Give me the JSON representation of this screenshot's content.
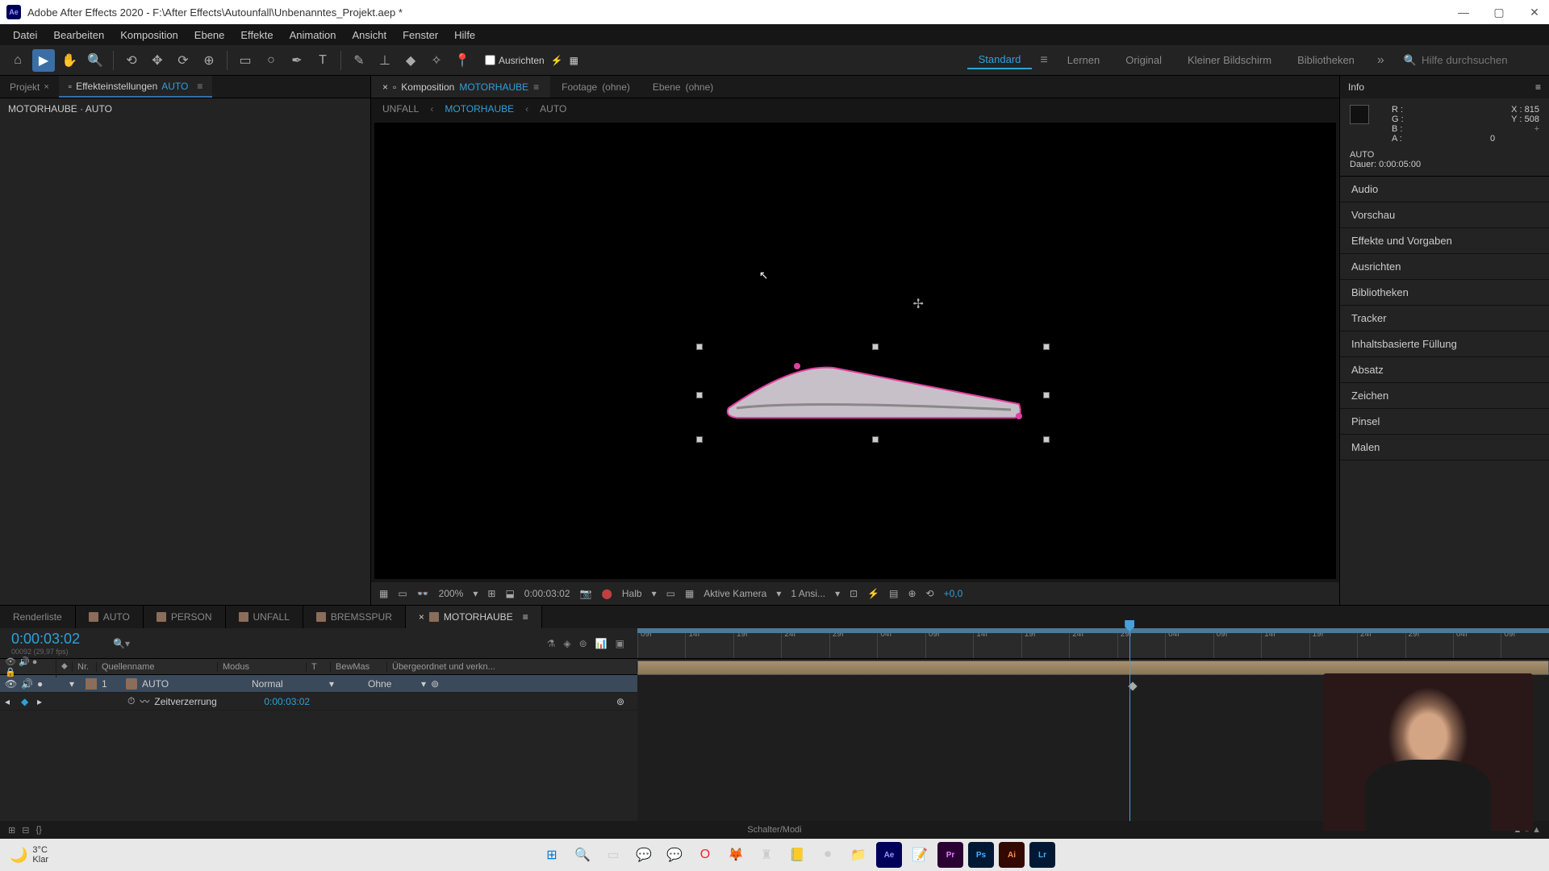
{
  "titlebar": {
    "icon_label": "Ae",
    "title": "Adobe After Effects 2020 - F:\\After Effects\\Autounfall\\Unbenanntes_Projekt.aep *",
    "minimize": "—",
    "maximize": "▢",
    "close": "✕"
  },
  "menubar": {
    "items": [
      "Datei",
      "Bearbeiten",
      "Komposition",
      "Ebene",
      "Effekte",
      "Animation",
      "Ansicht",
      "Fenster",
      "Hilfe"
    ]
  },
  "toolbar": {
    "ausrichten_label": "Ausrichten",
    "workspaces": [
      "Standard",
      "Lernen",
      "Original",
      "Kleiner Bildschirm",
      "Bibliotheken"
    ],
    "search_placeholder": "Hilfe durchsuchen"
  },
  "left_panel": {
    "tabs": {
      "projekt": "Projekt",
      "effekt": "Effekteinstellungen",
      "effekt_target": "AUTO"
    },
    "body_line": "MOTORHAUBE · AUTO"
  },
  "center_panel": {
    "comp_tabs": {
      "komposition": "Komposition",
      "komposition_name": "MOTORHAUBE",
      "footage": "Footage",
      "footage_sub": "(ohne)",
      "ebene": "Ebene",
      "ebene_sub": "(ohne)"
    },
    "breadcrumb": [
      "UNFALL",
      "MOTORHAUBE",
      "AUTO"
    ]
  },
  "viewport_footer": {
    "zoom": "200%",
    "timecode": "0:00:03:02",
    "resolution": "Halb",
    "camera": "Aktive Kamera",
    "views": "1 Ansi...",
    "exposure": "+0,0"
  },
  "right_panel": {
    "info_title": "Info",
    "rgba": {
      "R": "R :",
      "G": "G :",
      "B": "B :",
      "A": "A :",
      "a_val": "0"
    },
    "xy": {
      "X": "X :",
      "x_val": "815",
      "Y": "Y :",
      "y_val": "508"
    },
    "layer_name": "AUTO",
    "duration_label": "Dauer:",
    "duration_value": "0:00:05:00",
    "sections": [
      "Audio",
      "Vorschau",
      "Effekte und Vorgaben",
      "Ausrichten",
      "Bibliotheken",
      "Tracker",
      "Inhaltsbasierte Füllung",
      "Absatz",
      "Zeichen",
      "Pinsel",
      "Malen"
    ]
  },
  "timeline": {
    "tabs": [
      "Renderliste",
      "AUTO",
      "PERSON",
      "UNFALL",
      "BREMSSPUR",
      "MOTORHAUBE"
    ],
    "timecode": "0:00:03:02",
    "timecode_sub": "00092 (29,97 fps)",
    "header_cols": {
      "nr": "Nr.",
      "quelle": "Quellenname",
      "modus": "Modus",
      "t": "T",
      "bewmas": "BewMas",
      "ueber": "Übergeordnet und verkn..."
    },
    "layer": {
      "nr": "1",
      "name": "AUTO",
      "modus": "Normal",
      "maske": "Ohne"
    },
    "property": {
      "name": "Zeitverzerrung",
      "value": "0:00:03:02"
    },
    "ruler_ticks": [
      "09f",
      "14f",
      "19f",
      "24f",
      "29f",
      "04f",
      "09f",
      "14f",
      "19f",
      "24f",
      "29f",
      "04f",
      "09f",
      "14f",
      "19f",
      "24f",
      "29f",
      "04f",
      "09f"
    ],
    "footer": {
      "schalter": "Schalter/Modi"
    }
  },
  "taskbar": {
    "temp": "3°C",
    "condition": "Klar"
  }
}
